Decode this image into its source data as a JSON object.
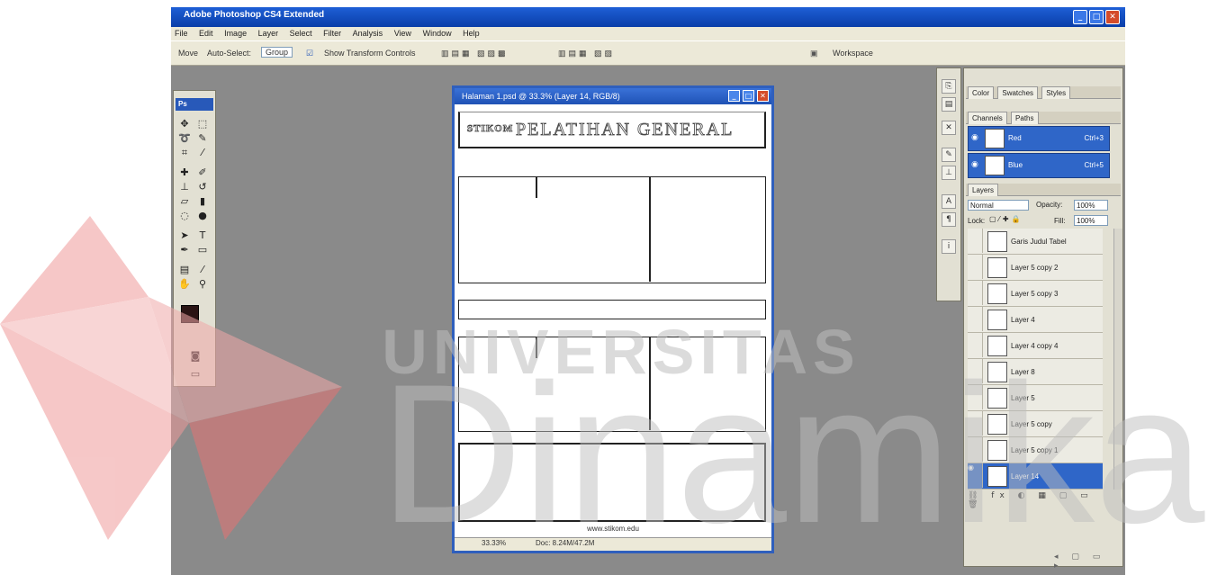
{
  "window": {
    "title": "Adobe Photoshop CS4 Extended"
  },
  "menu": [
    "File",
    "Edit",
    "Image",
    "Layer",
    "Select",
    "Filter",
    "Analysis",
    "View",
    "Window",
    "Help"
  ],
  "options_bar": {
    "tool": "Move",
    "auto_select_label": "Auto-Select:",
    "auto_select_value": "Group",
    "show_transform_label": "Show Transform Controls",
    "workspace_label": "Workspace"
  },
  "toolbox": {
    "badge": "Ps",
    "tools": [
      "move",
      "marquee",
      "lasso",
      "quick-select",
      "crop",
      "slice",
      "heal",
      "brush",
      "stamp",
      "history-brush",
      "eraser",
      "gradient",
      "blur",
      "dodge",
      "path-select",
      "type",
      "pen",
      "shape",
      "notes",
      "eyedropper",
      "hand",
      "zoom"
    ]
  },
  "document": {
    "title": "Halaman 1.psd @ 33.3% (Layer 14, RGB/8)",
    "header_small": "STIKOM",
    "header_big": "PELATIHAN GENERAL",
    "footer_text": "www.stikom.edu",
    "zoom": "33.33%",
    "status": "Doc: 8.24M/47.2M"
  },
  "panels": {
    "top_tabs": [
      "Color",
      "Swatches",
      "Styles"
    ],
    "mid_tabs": [
      "Channels",
      "Paths"
    ],
    "channels": [
      {
        "name": "Red",
        "key": "Ctrl+3"
      },
      {
        "name": "Blue",
        "key": "Ctrl+5"
      }
    ],
    "layers_tab": "Layers",
    "blend_mode": "Normal",
    "opacity_label": "Opacity:",
    "opacity_value": "100%",
    "lock_label": "Lock:",
    "fill_label": "Fill:",
    "fill_value": "100%",
    "layers": [
      {
        "name": "Garis Judul Tabel"
      },
      {
        "name": "Layer 5 copy 2"
      },
      {
        "name": "Layer 5 copy 3"
      },
      {
        "name": "Layer 4"
      },
      {
        "name": "Layer 4 copy 4"
      },
      {
        "name": "Layer 8"
      },
      {
        "name": "Layer 5"
      },
      {
        "name": "Layer 5 copy"
      },
      {
        "name": "Layer 5 copy 1"
      },
      {
        "name": "Layer 14"
      }
    ]
  },
  "watermark": {
    "line1": "UNIVERSITAS",
    "line2": "Dinamika"
  }
}
